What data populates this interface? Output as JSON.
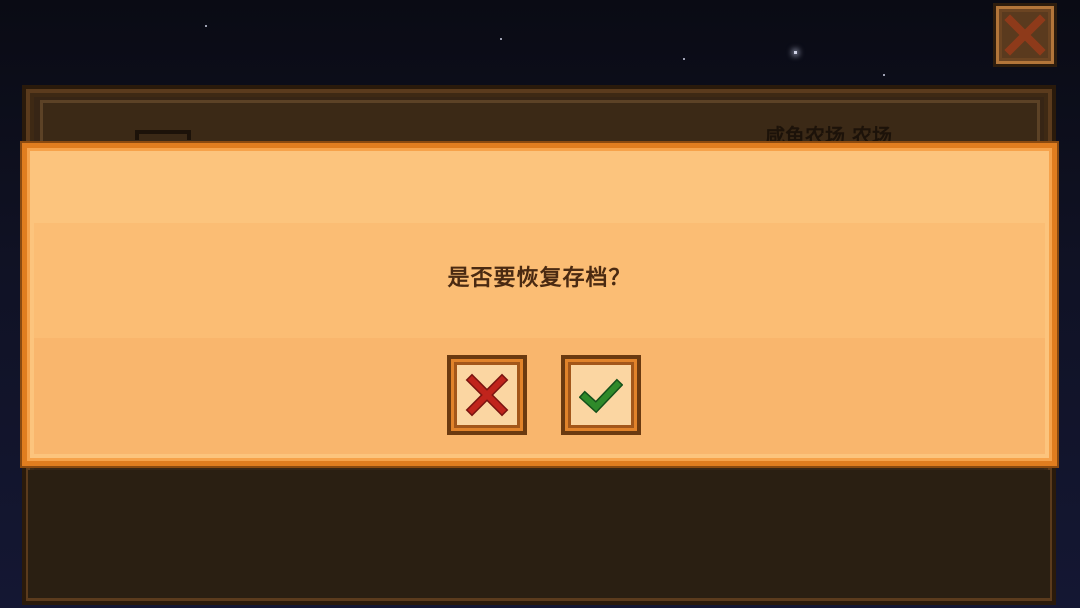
{
  "dialog": {
    "message": "是否要恢复存档？",
    "cancel_icon": "red-x-icon",
    "confirm_icon": "green-checkmark-icon"
  },
  "background": {
    "slot_farm_text": "咸鱼农场 农场",
    "close_icon": "close-x-icon"
  },
  "colors": {
    "dialog_fill": "#fbbd74",
    "dialog_border": "#e07d1f",
    "cancel_x": "#c0241c",
    "confirm_check": "#2f8a2a",
    "night_sky": "#101225"
  }
}
